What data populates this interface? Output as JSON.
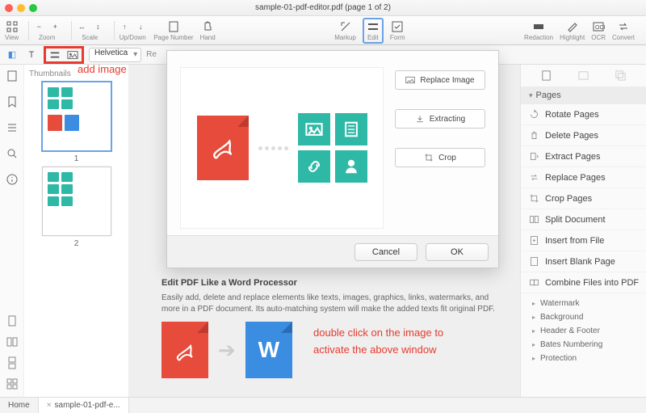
{
  "window": {
    "title": "sample-01-pdf-editor.pdf (page 1 of 2)"
  },
  "toolbar": {
    "view": "View",
    "zoom": "Zoom",
    "scale": "Scale",
    "updown": "Up/Down",
    "pagenum": "Page Number",
    "hand": "Hand",
    "markup": "Markup",
    "edit": "Edit",
    "form": "Form",
    "redaction": "Redaction",
    "highlight": "Highlight",
    "ocr": "OCR",
    "convert": "Convert"
  },
  "subbar": {
    "font": "Helvetica",
    "re": "Re"
  },
  "annotations": {
    "add_image": "add image",
    "dblclick_l1": "double click on the image to",
    "dblclick_l2": "activate the above window"
  },
  "thumbnails": {
    "header": "Thumbnails",
    "p1": "1",
    "p2": "2"
  },
  "document": {
    "heading": "Edit PDF Like a Word Processor",
    "body": "Easily add, delete and replace elements like texts, images, graphics, links, watermarks, and more in a PDF document. Its auto-matching system will make the added texts fit original PDF.",
    "word_letter": "W"
  },
  "modal": {
    "replace": "Replace Image",
    "extracting": "Extracting",
    "crop": "Crop",
    "cancel": "Cancel",
    "ok": "OK"
  },
  "right": {
    "pages_header": "Pages",
    "items": {
      "rotate": "Rotate Pages",
      "delete": "Delete Pages",
      "extract": "Extract Pages",
      "replace": "Replace Pages",
      "crop": "Crop Pages",
      "split": "Split Document",
      "insert_file": "Insert from File",
      "insert_blank": "Insert Blank Page",
      "combine": "Combine Files into PDF"
    },
    "more": {
      "watermark": "Watermark",
      "background": "Background",
      "headerfooter": "Header & Footer",
      "bates": "Bates Numbering",
      "protection": "Protection"
    }
  },
  "tabs": {
    "home": "Home",
    "file1": "sample-01-pdf-e..."
  }
}
